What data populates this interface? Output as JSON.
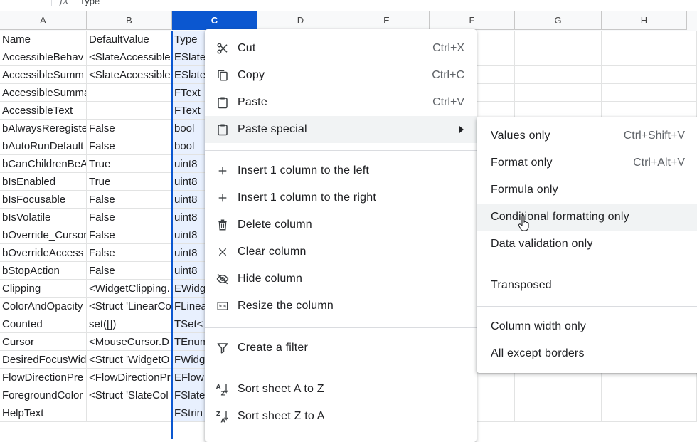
{
  "formula_bar": {
    "fx": "fx",
    "value": "Type"
  },
  "columns": [
    {
      "label": "A"
    },
    {
      "label": "B"
    },
    {
      "label": "C"
    },
    {
      "label": "D"
    },
    {
      "label": "E"
    },
    {
      "label": "F"
    },
    {
      "label": "G"
    },
    {
      "label": "H"
    }
  ],
  "selected_column": "C",
  "rows": [
    [
      "Name",
      "DefaultValue",
      "Type"
    ],
    [
      "AccessibleBehav",
      "<SlateAccessible",
      "ESlate"
    ],
    [
      "AccessibleSumm",
      "<SlateAccessible",
      "ESlate"
    ],
    [
      "AccessibleSummaryText",
      "",
      "FText"
    ],
    [
      "AccessibleText",
      "",
      "FText"
    ],
    [
      "bAlwaysReregiste",
      "False",
      "bool"
    ],
    [
      "bAutoRunDefault",
      "False",
      "bool"
    ],
    [
      "bCanChildrenBeA",
      "True",
      "uint8"
    ],
    [
      "bIsEnabled",
      "True",
      "uint8"
    ],
    [
      "bIsFocusable",
      "False",
      "uint8"
    ],
    [
      "bIsVolatile",
      "False",
      "uint8"
    ],
    [
      "bOverride_Cursor",
      "False",
      "uint8"
    ],
    [
      "bOverrideAccess",
      "False",
      "uint8"
    ],
    [
      "bStopAction",
      "False",
      "uint8"
    ],
    [
      "Clipping",
      "<WidgetClipping.",
      "EWidg"
    ],
    [
      "ColorAndOpacity",
      "<Struct 'LinearCo",
      "FLinea"
    ],
    [
      "Counted",
      "set([])",
      "TSet<"
    ],
    [
      "Cursor",
      "<MouseCursor.D",
      "TEnum"
    ],
    [
      "DesiredFocusWid",
      "<Struct 'WidgetO",
      "FWidg"
    ],
    [
      "FlowDirectionPre",
      "<FlowDirectionPr",
      "EFlow"
    ],
    [
      "ForegroundColor",
      "<Struct 'SlateCol",
      "FSlate"
    ],
    [
      "HelpText",
      "",
      "FStrin"
    ]
  ],
  "context_menu": {
    "items": [
      {
        "label": "Cut",
        "shortcut": "Ctrl+X",
        "icon": "scissors-icon"
      },
      {
        "label": "Copy",
        "shortcut": "Ctrl+C",
        "icon": "copy-icon"
      },
      {
        "label": "Paste",
        "shortcut": "Ctrl+V",
        "icon": "clipboard-icon"
      },
      {
        "label": "Paste special",
        "shortcut": "",
        "icon": "clipboard-icon"
      },
      {
        "label": "Insert 1 column to the left",
        "shortcut": "",
        "icon": "plus-icon"
      },
      {
        "label": "Insert 1 column to the right",
        "shortcut": "",
        "icon": "plus-icon"
      },
      {
        "label": "Delete column",
        "shortcut": "",
        "icon": "trash-icon"
      },
      {
        "label": "Clear column",
        "shortcut": "",
        "icon": "close-icon"
      },
      {
        "label": "Hide column",
        "shortcut": "",
        "icon": "eye-off-icon"
      },
      {
        "label": "Resize the column",
        "shortcut": "",
        "icon": "resize-icon"
      },
      {
        "label": "Create a filter",
        "shortcut": "",
        "icon": "filter-icon"
      },
      {
        "label": "Sort sheet A to Z",
        "shortcut": "",
        "icon": "sort-az-icon"
      },
      {
        "label": "Sort sheet Z to A",
        "shortcut": "",
        "icon": "sort-za-icon"
      }
    ]
  },
  "paste_special_menu": {
    "items": [
      {
        "label": "Values only",
        "shortcut": "Ctrl+Shift+V"
      },
      {
        "label": "Format only",
        "shortcut": "Ctrl+Alt+V"
      },
      {
        "label": "Formula only",
        "shortcut": ""
      },
      {
        "label": "Conditional formatting only",
        "shortcut": ""
      },
      {
        "label": "Data validation only",
        "shortcut": ""
      },
      {
        "label": "Transposed",
        "shortcut": ""
      },
      {
        "label": "Column width only",
        "shortcut": ""
      },
      {
        "label": "All except borders",
        "shortcut": ""
      }
    ]
  }
}
